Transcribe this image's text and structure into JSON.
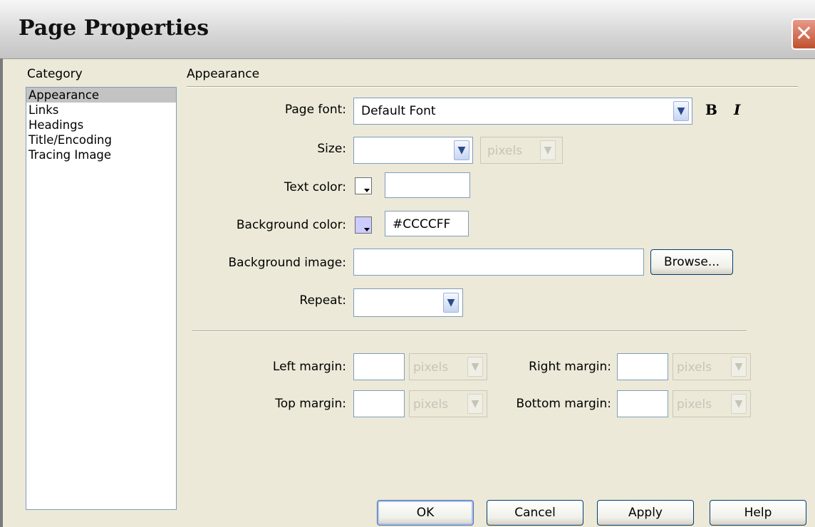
{
  "window": {
    "title": "Page Properties",
    "close_glyph": "✕"
  },
  "category": {
    "heading": "Category",
    "items": [
      "Appearance",
      "Links",
      "Headings",
      "Title/Encoding",
      "Tracing Image"
    ],
    "selected_index": 0
  },
  "section": {
    "heading": "Appearance"
  },
  "fields": {
    "page_font": {
      "label": "Page font:",
      "value": "Default Font"
    },
    "size": {
      "label": "Size:",
      "value": "",
      "unit": "pixels"
    },
    "text_color": {
      "label": "Text color:",
      "value": "",
      "swatch": "#ffffff"
    },
    "background_color": {
      "label": "Background color:",
      "value": "#CCCCFF",
      "swatch": "#ccccff"
    },
    "background_image": {
      "label": "Background image:",
      "value": "",
      "browse_label": "Browse..."
    },
    "repeat": {
      "label": "Repeat:",
      "value": ""
    }
  },
  "margins": {
    "left": {
      "label": "Left margin:",
      "value": "",
      "unit": "pixels"
    },
    "right": {
      "label": "Right margin:",
      "value": "",
      "unit": "pixels"
    },
    "top": {
      "label": "Top margin:",
      "value": "",
      "unit": "pixels"
    },
    "bottom": {
      "label": "Bottom margin:",
      "value": "",
      "unit": "pixels"
    }
  },
  "style_buttons": {
    "bold": "B",
    "italic": "I"
  },
  "buttons": {
    "ok": "OK",
    "cancel": "Cancel",
    "apply": "Apply",
    "help": "Help"
  },
  "icons": {
    "dropdown": "chevron-down-icon",
    "close": "close-icon"
  }
}
